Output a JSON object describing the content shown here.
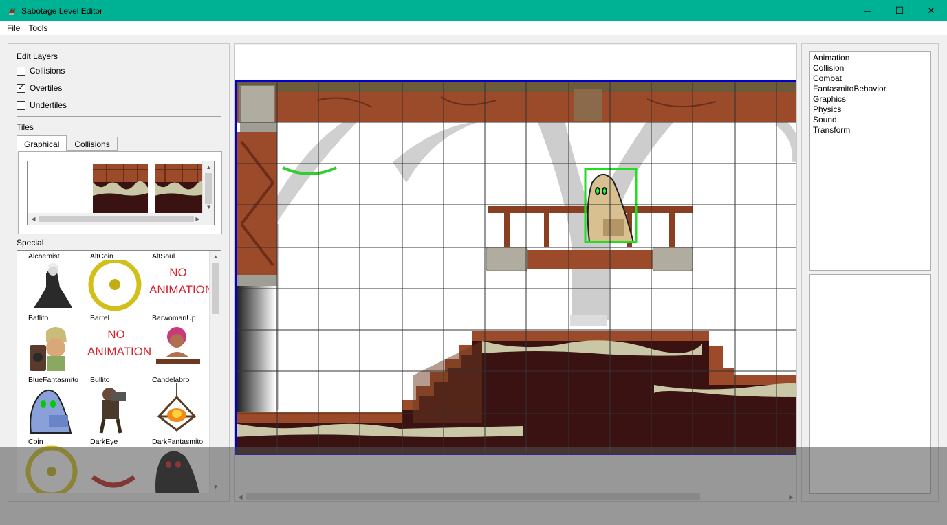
{
  "window": {
    "title": "Sabotage Level Editor",
    "controls": {
      "minimize": "─",
      "maximize": "☐",
      "close": "✕"
    }
  },
  "menu": [
    "File",
    "Tools"
  ],
  "left_panel": {
    "edit_layers": {
      "label": "Edit Layers",
      "items": [
        {
          "label": "Collisions",
          "checked": false
        },
        {
          "label": "Overtiles",
          "checked": true
        },
        {
          "label": "Undertiles",
          "checked": false
        }
      ]
    },
    "tiles": {
      "label": "Tiles",
      "tabs": [
        {
          "label": "Graphical",
          "active": true
        },
        {
          "label": "Collisions",
          "active": false
        }
      ]
    },
    "special": {
      "label": "Special",
      "items": [
        "Alchemist",
        "AltCoin",
        "AltSoul",
        "Baflito",
        "Barrel",
        "BarwomanUp",
        "BlueFantasmito",
        "Bullito",
        "Candelabro",
        "Coin",
        "DarkEye",
        "DarkFantasmito"
      ],
      "no_animation_text": [
        "NO",
        "ANIMATION"
      ]
    }
  },
  "right_panel": {
    "components": [
      "Animation",
      "Collision",
      "Combat",
      "FantasmitoBehavior",
      "Graphics",
      "Physics",
      "Sound",
      "Transform"
    ]
  },
  "colors": {
    "titlebar": "#00b294",
    "level_border": "#0000cc",
    "selection": "#22dd22",
    "wood": "#9b4a2a",
    "dark_dirt": "#3a1212"
  }
}
